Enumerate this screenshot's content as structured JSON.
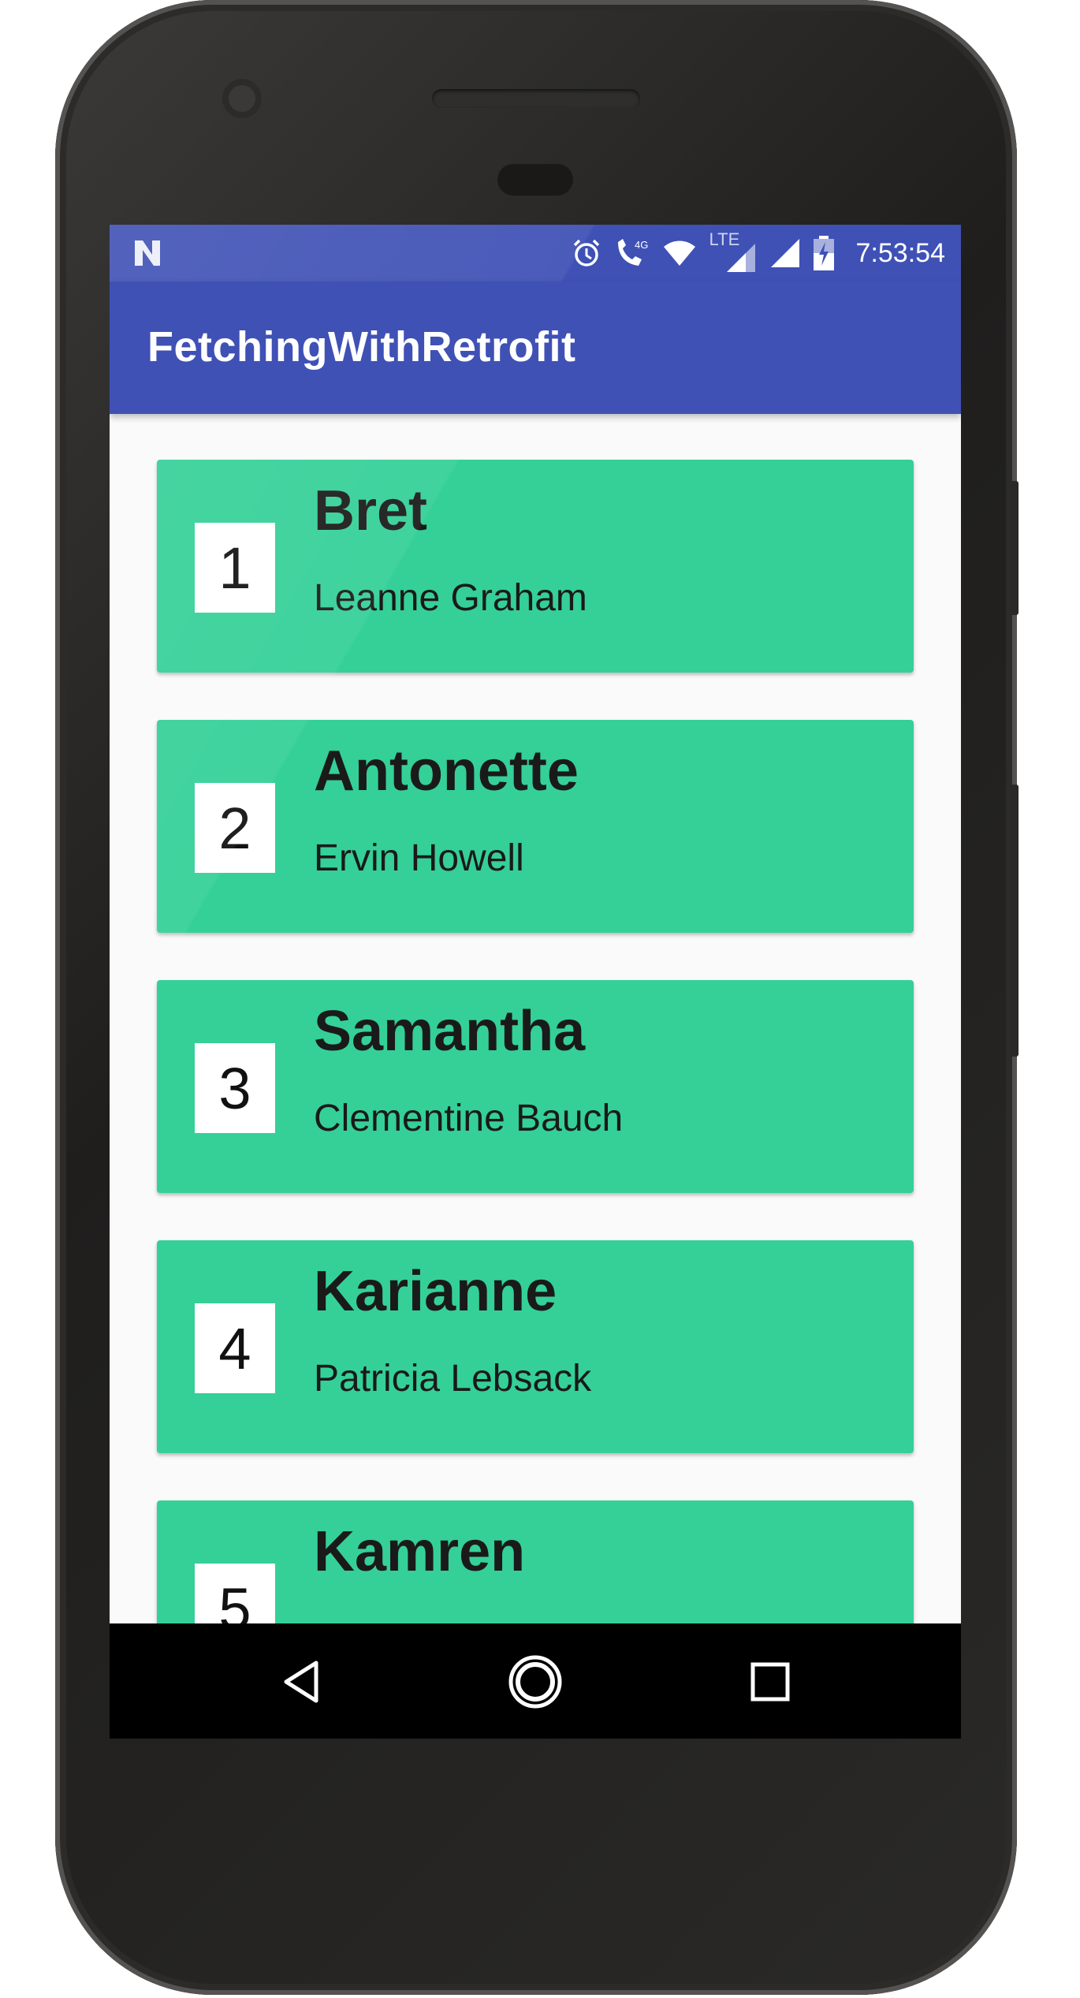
{
  "status_bar": {
    "time": "7:53:54",
    "network_label": "4G",
    "lte_label": "LTE",
    "icons": [
      "n-notification-icon",
      "alarm-icon",
      "wifi-calling-icon",
      "wifi-icon",
      "lte-signal-icon",
      "cell-signal-icon",
      "battery-charging-icon"
    ]
  },
  "app_bar": {
    "title": "FetchingWithRetrofit",
    "color": "#3f51b5"
  },
  "list": {
    "card_color": "#34d098",
    "items": [
      {
        "id": "1",
        "username": "Bret",
        "name": "Leanne Graham"
      },
      {
        "id": "2",
        "username": "Antonette",
        "name": "Ervin Howell"
      },
      {
        "id": "3",
        "username": "Samantha",
        "name": "Clementine Bauch"
      },
      {
        "id": "4",
        "username": "Karianne",
        "name": "Patricia Lebsack"
      },
      {
        "id": "5",
        "username": "Kamren",
        "name": ""
      }
    ]
  },
  "nav_bar": {
    "icons": [
      "back-icon",
      "home-icon",
      "recents-icon"
    ]
  }
}
